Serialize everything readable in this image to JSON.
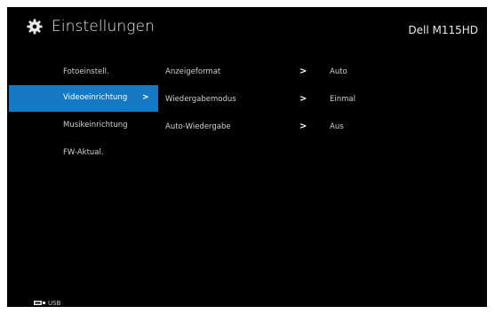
{
  "header": {
    "title": "Einstellungen",
    "model": "Dell M115HD",
    "settings_icon": "gear-icon"
  },
  "left_menu": {
    "items": [
      {
        "label": "Fotoeinstell.",
        "selected": false
      },
      {
        "label": "Videoeinrichtung",
        "selected": true
      },
      {
        "label": "Musikeinrichtung",
        "selected": false
      },
      {
        "label": "FW-Aktual.",
        "selected": false
      }
    ],
    "selected_chevron": ">"
  },
  "right_menu": {
    "rows": [
      {
        "label": "Anzeigeformat",
        "chevron": ">",
        "value": "Auto"
      },
      {
        "label": "Wiedergabemodus",
        "chevron": ">",
        "value": "Einmal"
      },
      {
        "label": "Auto-Wiedergabe",
        "chevron": ">",
        "value": "Aus"
      }
    ]
  },
  "footer": {
    "source_label": "USB",
    "source_icon": "usb-icon"
  },
  "colors": {
    "background": "#000000",
    "accent": "#1479c2",
    "text": "#e8e8e8"
  }
}
